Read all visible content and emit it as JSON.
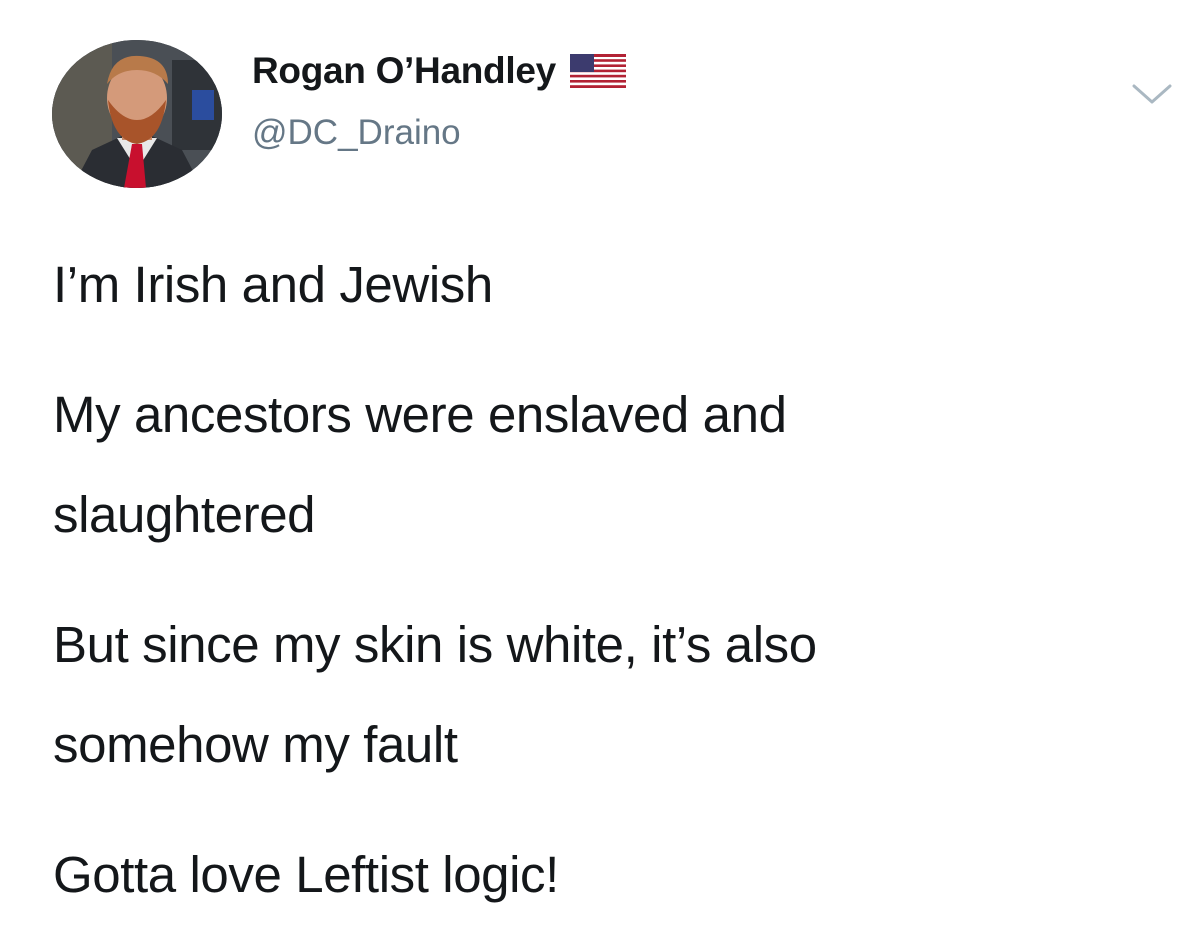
{
  "author": {
    "display_name": "Rogan O’Handley",
    "handle": "@DC_Draino",
    "name_emoji": "us-flag-icon"
  },
  "tweet": {
    "lines": [
      "I’m Irish and Jewish",
      "My ancestors were enslaved and",
      "slaughtered",
      "But since my skin is white, it’s also",
      "somehow my fault",
      "Gotta love Leftist logic!"
    ]
  },
  "colors": {
    "text": "#14171a",
    "secondary_text": "#657786",
    "background": "#ffffff",
    "caret": "#aab8c2"
  }
}
